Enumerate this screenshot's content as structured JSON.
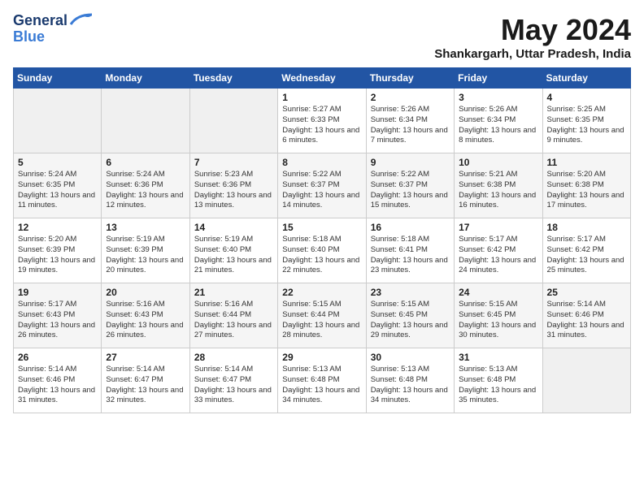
{
  "logo": {
    "line1": "General",
    "line2": "Blue"
  },
  "title": "May 2024",
  "location": "Shankargarh, Uttar Pradesh, India",
  "weekdays": [
    "Sunday",
    "Monday",
    "Tuesday",
    "Wednesday",
    "Thursday",
    "Friday",
    "Saturday"
  ],
  "weeks": [
    [
      {
        "day": "",
        "content": ""
      },
      {
        "day": "",
        "content": ""
      },
      {
        "day": "",
        "content": ""
      },
      {
        "day": "1",
        "content": "Sunrise: 5:27 AM\nSunset: 6:33 PM\nDaylight: 13 hours\nand 6 minutes."
      },
      {
        "day": "2",
        "content": "Sunrise: 5:26 AM\nSunset: 6:34 PM\nDaylight: 13 hours\nand 7 minutes."
      },
      {
        "day": "3",
        "content": "Sunrise: 5:26 AM\nSunset: 6:34 PM\nDaylight: 13 hours\nand 8 minutes."
      },
      {
        "day": "4",
        "content": "Sunrise: 5:25 AM\nSunset: 6:35 PM\nDaylight: 13 hours\nand 9 minutes."
      }
    ],
    [
      {
        "day": "5",
        "content": "Sunrise: 5:24 AM\nSunset: 6:35 PM\nDaylight: 13 hours\nand 11 minutes."
      },
      {
        "day": "6",
        "content": "Sunrise: 5:24 AM\nSunset: 6:36 PM\nDaylight: 13 hours\nand 12 minutes."
      },
      {
        "day": "7",
        "content": "Sunrise: 5:23 AM\nSunset: 6:36 PM\nDaylight: 13 hours\nand 13 minutes."
      },
      {
        "day": "8",
        "content": "Sunrise: 5:22 AM\nSunset: 6:37 PM\nDaylight: 13 hours\nand 14 minutes."
      },
      {
        "day": "9",
        "content": "Sunrise: 5:22 AM\nSunset: 6:37 PM\nDaylight: 13 hours\nand 15 minutes."
      },
      {
        "day": "10",
        "content": "Sunrise: 5:21 AM\nSunset: 6:38 PM\nDaylight: 13 hours\nand 16 minutes."
      },
      {
        "day": "11",
        "content": "Sunrise: 5:20 AM\nSunset: 6:38 PM\nDaylight: 13 hours\nand 17 minutes."
      }
    ],
    [
      {
        "day": "12",
        "content": "Sunrise: 5:20 AM\nSunset: 6:39 PM\nDaylight: 13 hours\nand 19 minutes."
      },
      {
        "day": "13",
        "content": "Sunrise: 5:19 AM\nSunset: 6:39 PM\nDaylight: 13 hours\nand 20 minutes."
      },
      {
        "day": "14",
        "content": "Sunrise: 5:19 AM\nSunset: 6:40 PM\nDaylight: 13 hours\nand 21 minutes."
      },
      {
        "day": "15",
        "content": "Sunrise: 5:18 AM\nSunset: 6:40 PM\nDaylight: 13 hours\nand 22 minutes."
      },
      {
        "day": "16",
        "content": "Sunrise: 5:18 AM\nSunset: 6:41 PM\nDaylight: 13 hours\nand 23 minutes."
      },
      {
        "day": "17",
        "content": "Sunrise: 5:17 AM\nSunset: 6:42 PM\nDaylight: 13 hours\nand 24 minutes."
      },
      {
        "day": "18",
        "content": "Sunrise: 5:17 AM\nSunset: 6:42 PM\nDaylight: 13 hours\nand 25 minutes."
      }
    ],
    [
      {
        "day": "19",
        "content": "Sunrise: 5:17 AM\nSunset: 6:43 PM\nDaylight: 13 hours\nand 26 minutes."
      },
      {
        "day": "20",
        "content": "Sunrise: 5:16 AM\nSunset: 6:43 PM\nDaylight: 13 hours\nand 26 minutes."
      },
      {
        "day": "21",
        "content": "Sunrise: 5:16 AM\nSunset: 6:44 PM\nDaylight: 13 hours\nand 27 minutes."
      },
      {
        "day": "22",
        "content": "Sunrise: 5:15 AM\nSunset: 6:44 PM\nDaylight: 13 hours\nand 28 minutes."
      },
      {
        "day": "23",
        "content": "Sunrise: 5:15 AM\nSunset: 6:45 PM\nDaylight: 13 hours\nand 29 minutes."
      },
      {
        "day": "24",
        "content": "Sunrise: 5:15 AM\nSunset: 6:45 PM\nDaylight: 13 hours\nand 30 minutes."
      },
      {
        "day": "25",
        "content": "Sunrise: 5:14 AM\nSunset: 6:46 PM\nDaylight: 13 hours\nand 31 minutes."
      }
    ],
    [
      {
        "day": "26",
        "content": "Sunrise: 5:14 AM\nSunset: 6:46 PM\nDaylight: 13 hours\nand 31 minutes."
      },
      {
        "day": "27",
        "content": "Sunrise: 5:14 AM\nSunset: 6:47 PM\nDaylight: 13 hours\nand 32 minutes."
      },
      {
        "day": "28",
        "content": "Sunrise: 5:14 AM\nSunset: 6:47 PM\nDaylight: 13 hours\nand 33 minutes."
      },
      {
        "day": "29",
        "content": "Sunrise: 5:13 AM\nSunset: 6:48 PM\nDaylight: 13 hours\nand 34 minutes."
      },
      {
        "day": "30",
        "content": "Sunrise: 5:13 AM\nSunset: 6:48 PM\nDaylight: 13 hours\nand 34 minutes."
      },
      {
        "day": "31",
        "content": "Sunrise: 5:13 AM\nSunset: 6:48 PM\nDaylight: 13 hours\nand 35 minutes."
      },
      {
        "day": "",
        "content": ""
      }
    ]
  ]
}
